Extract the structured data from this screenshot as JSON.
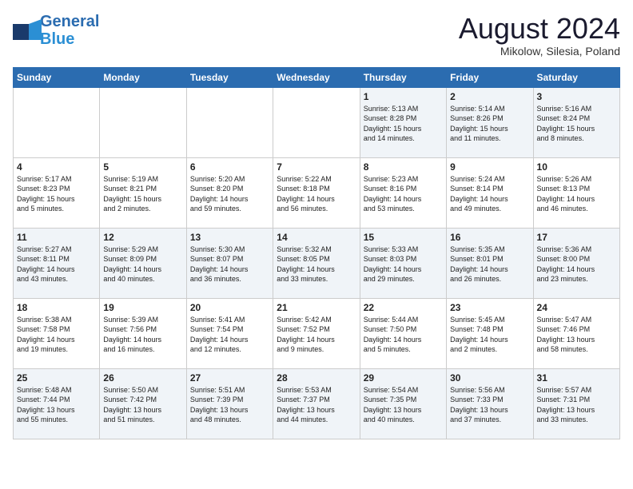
{
  "header": {
    "logo_line1": "General",
    "logo_line2": "Blue",
    "month": "August 2024",
    "location": "Mikolow, Silesia, Poland"
  },
  "weekdays": [
    "Sunday",
    "Monday",
    "Tuesday",
    "Wednesday",
    "Thursday",
    "Friday",
    "Saturday"
  ],
  "weeks": [
    [
      {
        "day": "",
        "info": ""
      },
      {
        "day": "",
        "info": ""
      },
      {
        "day": "",
        "info": ""
      },
      {
        "day": "",
        "info": ""
      },
      {
        "day": "1",
        "info": "Sunrise: 5:13 AM\nSunset: 8:28 PM\nDaylight: 15 hours\nand 14 minutes."
      },
      {
        "day": "2",
        "info": "Sunrise: 5:14 AM\nSunset: 8:26 PM\nDaylight: 15 hours\nand 11 minutes."
      },
      {
        "day": "3",
        "info": "Sunrise: 5:16 AM\nSunset: 8:24 PM\nDaylight: 15 hours\nand 8 minutes."
      }
    ],
    [
      {
        "day": "4",
        "info": "Sunrise: 5:17 AM\nSunset: 8:23 PM\nDaylight: 15 hours\nand 5 minutes."
      },
      {
        "day": "5",
        "info": "Sunrise: 5:19 AM\nSunset: 8:21 PM\nDaylight: 15 hours\nand 2 minutes."
      },
      {
        "day": "6",
        "info": "Sunrise: 5:20 AM\nSunset: 8:20 PM\nDaylight: 14 hours\nand 59 minutes."
      },
      {
        "day": "7",
        "info": "Sunrise: 5:22 AM\nSunset: 8:18 PM\nDaylight: 14 hours\nand 56 minutes."
      },
      {
        "day": "8",
        "info": "Sunrise: 5:23 AM\nSunset: 8:16 PM\nDaylight: 14 hours\nand 53 minutes."
      },
      {
        "day": "9",
        "info": "Sunrise: 5:24 AM\nSunset: 8:14 PM\nDaylight: 14 hours\nand 49 minutes."
      },
      {
        "day": "10",
        "info": "Sunrise: 5:26 AM\nSunset: 8:13 PM\nDaylight: 14 hours\nand 46 minutes."
      }
    ],
    [
      {
        "day": "11",
        "info": "Sunrise: 5:27 AM\nSunset: 8:11 PM\nDaylight: 14 hours\nand 43 minutes."
      },
      {
        "day": "12",
        "info": "Sunrise: 5:29 AM\nSunset: 8:09 PM\nDaylight: 14 hours\nand 40 minutes."
      },
      {
        "day": "13",
        "info": "Sunrise: 5:30 AM\nSunset: 8:07 PM\nDaylight: 14 hours\nand 36 minutes."
      },
      {
        "day": "14",
        "info": "Sunrise: 5:32 AM\nSunset: 8:05 PM\nDaylight: 14 hours\nand 33 minutes."
      },
      {
        "day": "15",
        "info": "Sunrise: 5:33 AM\nSunset: 8:03 PM\nDaylight: 14 hours\nand 29 minutes."
      },
      {
        "day": "16",
        "info": "Sunrise: 5:35 AM\nSunset: 8:01 PM\nDaylight: 14 hours\nand 26 minutes."
      },
      {
        "day": "17",
        "info": "Sunrise: 5:36 AM\nSunset: 8:00 PM\nDaylight: 14 hours\nand 23 minutes."
      }
    ],
    [
      {
        "day": "18",
        "info": "Sunrise: 5:38 AM\nSunset: 7:58 PM\nDaylight: 14 hours\nand 19 minutes."
      },
      {
        "day": "19",
        "info": "Sunrise: 5:39 AM\nSunset: 7:56 PM\nDaylight: 14 hours\nand 16 minutes."
      },
      {
        "day": "20",
        "info": "Sunrise: 5:41 AM\nSunset: 7:54 PM\nDaylight: 14 hours\nand 12 minutes."
      },
      {
        "day": "21",
        "info": "Sunrise: 5:42 AM\nSunset: 7:52 PM\nDaylight: 14 hours\nand 9 minutes."
      },
      {
        "day": "22",
        "info": "Sunrise: 5:44 AM\nSunset: 7:50 PM\nDaylight: 14 hours\nand 5 minutes."
      },
      {
        "day": "23",
        "info": "Sunrise: 5:45 AM\nSunset: 7:48 PM\nDaylight: 14 hours\nand 2 minutes."
      },
      {
        "day": "24",
        "info": "Sunrise: 5:47 AM\nSunset: 7:46 PM\nDaylight: 13 hours\nand 58 minutes."
      }
    ],
    [
      {
        "day": "25",
        "info": "Sunrise: 5:48 AM\nSunset: 7:44 PM\nDaylight: 13 hours\nand 55 minutes."
      },
      {
        "day": "26",
        "info": "Sunrise: 5:50 AM\nSunset: 7:42 PM\nDaylight: 13 hours\nand 51 minutes."
      },
      {
        "day": "27",
        "info": "Sunrise: 5:51 AM\nSunset: 7:39 PM\nDaylight: 13 hours\nand 48 minutes."
      },
      {
        "day": "28",
        "info": "Sunrise: 5:53 AM\nSunset: 7:37 PM\nDaylight: 13 hours\nand 44 minutes."
      },
      {
        "day": "29",
        "info": "Sunrise: 5:54 AM\nSunset: 7:35 PM\nDaylight: 13 hours\nand 40 minutes."
      },
      {
        "day": "30",
        "info": "Sunrise: 5:56 AM\nSunset: 7:33 PM\nDaylight: 13 hours\nand 37 minutes."
      },
      {
        "day": "31",
        "info": "Sunrise: 5:57 AM\nSunset: 7:31 PM\nDaylight: 13 hours\nand 33 minutes."
      }
    ]
  ]
}
